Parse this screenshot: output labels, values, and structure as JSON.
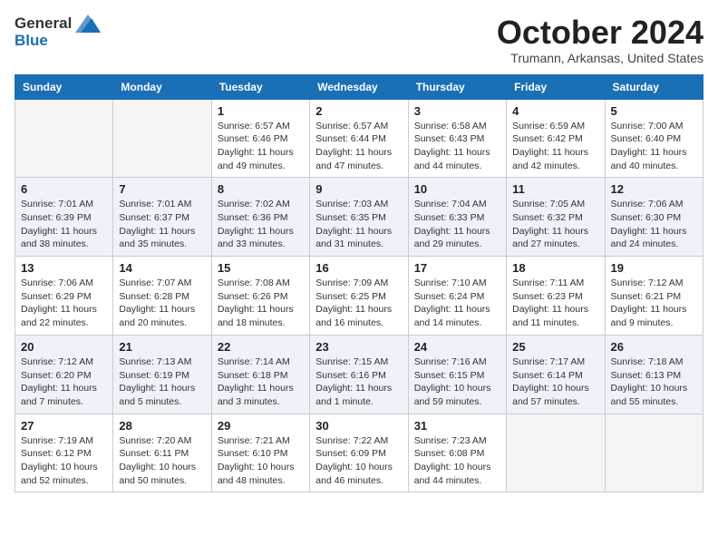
{
  "header": {
    "logo_general": "General",
    "logo_blue": "Blue",
    "month_title": "October 2024",
    "location": "Trumann, Arkansas, United States"
  },
  "weekdays": [
    "Sunday",
    "Monday",
    "Tuesday",
    "Wednesday",
    "Thursday",
    "Friday",
    "Saturday"
  ],
  "weeks": [
    [
      {
        "day": "",
        "info": ""
      },
      {
        "day": "",
        "info": ""
      },
      {
        "day": "1",
        "info": "Sunrise: 6:57 AM\nSunset: 6:46 PM\nDaylight: 11 hours and 49 minutes."
      },
      {
        "day": "2",
        "info": "Sunrise: 6:57 AM\nSunset: 6:44 PM\nDaylight: 11 hours and 47 minutes."
      },
      {
        "day": "3",
        "info": "Sunrise: 6:58 AM\nSunset: 6:43 PM\nDaylight: 11 hours and 44 minutes."
      },
      {
        "day": "4",
        "info": "Sunrise: 6:59 AM\nSunset: 6:42 PM\nDaylight: 11 hours and 42 minutes."
      },
      {
        "day": "5",
        "info": "Sunrise: 7:00 AM\nSunset: 6:40 PM\nDaylight: 11 hours and 40 minutes."
      }
    ],
    [
      {
        "day": "6",
        "info": "Sunrise: 7:01 AM\nSunset: 6:39 PM\nDaylight: 11 hours and 38 minutes."
      },
      {
        "day": "7",
        "info": "Sunrise: 7:01 AM\nSunset: 6:37 PM\nDaylight: 11 hours and 35 minutes."
      },
      {
        "day": "8",
        "info": "Sunrise: 7:02 AM\nSunset: 6:36 PM\nDaylight: 11 hours and 33 minutes."
      },
      {
        "day": "9",
        "info": "Sunrise: 7:03 AM\nSunset: 6:35 PM\nDaylight: 11 hours and 31 minutes."
      },
      {
        "day": "10",
        "info": "Sunrise: 7:04 AM\nSunset: 6:33 PM\nDaylight: 11 hours and 29 minutes."
      },
      {
        "day": "11",
        "info": "Sunrise: 7:05 AM\nSunset: 6:32 PM\nDaylight: 11 hours and 27 minutes."
      },
      {
        "day": "12",
        "info": "Sunrise: 7:06 AM\nSunset: 6:30 PM\nDaylight: 11 hours and 24 minutes."
      }
    ],
    [
      {
        "day": "13",
        "info": "Sunrise: 7:06 AM\nSunset: 6:29 PM\nDaylight: 11 hours and 22 minutes."
      },
      {
        "day": "14",
        "info": "Sunrise: 7:07 AM\nSunset: 6:28 PM\nDaylight: 11 hours and 20 minutes."
      },
      {
        "day": "15",
        "info": "Sunrise: 7:08 AM\nSunset: 6:26 PM\nDaylight: 11 hours and 18 minutes."
      },
      {
        "day": "16",
        "info": "Sunrise: 7:09 AM\nSunset: 6:25 PM\nDaylight: 11 hours and 16 minutes."
      },
      {
        "day": "17",
        "info": "Sunrise: 7:10 AM\nSunset: 6:24 PM\nDaylight: 11 hours and 14 minutes."
      },
      {
        "day": "18",
        "info": "Sunrise: 7:11 AM\nSunset: 6:23 PM\nDaylight: 11 hours and 11 minutes."
      },
      {
        "day": "19",
        "info": "Sunrise: 7:12 AM\nSunset: 6:21 PM\nDaylight: 11 hours and 9 minutes."
      }
    ],
    [
      {
        "day": "20",
        "info": "Sunrise: 7:12 AM\nSunset: 6:20 PM\nDaylight: 11 hours and 7 minutes."
      },
      {
        "day": "21",
        "info": "Sunrise: 7:13 AM\nSunset: 6:19 PM\nDaylight: 11 hours and 5 minutes."
      },
      {
        "day": "22",
        "info": "Sunrise: 7:14 AM\nSunset: 6:18 PM\nDaylight: 11 hours and 3 minutes."
      },
      {
        "day": "23",
        "info": "Sunrise: 7:15 AM\nSunset: 6:16 PM\nDaylight: 11 hours and 1 minute."
      },
      {
        "day": "24",
        "info": "Sunrise: 7:16 AM\nSunset: 6:15 PM\nDaylight: 10 hours and 59 minutes."
      },
      {
        "day": "25",
        "info": "Sunrise: 7:17 AM\nSunset: 6:14 PM\nDaylight: 10 hours and 57 minutes."
      },
      {
        "day": "26",
        "info": "Sunrise: 7:18 AM\nSunset: 6:13 PM\nDaylight: 10 hours and 55 minutes."
      }
    ],
    [
      {
        "day": "27",
        "info": "Sunrise: 7:19 AM\nSunset: 6:12 PM\nDaylight: 10 hours and 52 minutes."
      },
      {
        "day": "28",
        "info": "Sunrise: 7:20 AM\nSunset: 6:11 PM\nDaylight: 10 hours and 50 minutes."
      },
      {
        "day": "29",
        "info": "Sunrise: 7:21 AM\nSunset: 6:10 PM\nDaylight: 10 hours and 48 minutes."
      },
      {
        "day": "30",
        "info": "Sunrise: 7:22 AM\nSunset: 6:09 PM\nDaylight: 10 hours and 46 minutes."
      },
      {
        "day": "31",
        "info": "Sunrise: 7:23 AM\nSunset: 6:08 PM\nDaylight: 10 hours and 44 minutes."
      },
      {
        "day": "",
        "info": ""
      },
      {
        "day": "",
        "info": ""
      }
    ]
  ]
}
